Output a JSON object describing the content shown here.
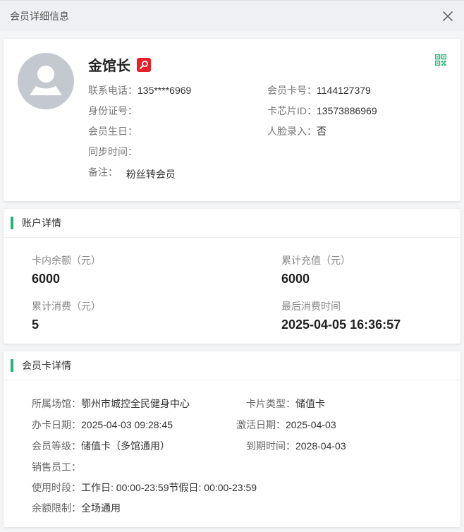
{
  "modal": {
    "title": "会员详细信息"
  },
  "member": {
    "name": "金馆长",
    "phone_label": "联系电话：",
    "phone": "135****6969",
    "card_no_label": "会员卡号：",
    "card_no": "1144127379",
    "id_label": "身份证号：",
    "id": "",
    "chip_label": "卡芯片ID：",
    "chip": "13573886969",
    "birthday_label": "会员生日：",
    "birthday": "",
    "face_label": "人脸录入：",
    "face": "否",
    "sync_label": "同步时间：",
    "sync": "",
    "note_label": "备注：",
    "note": "粉丝转会员"
  },
  "account": {
    "title": "账户详情",
    "balance_label": "卡内余额（元）",
    "balance": "6000",
    "recharge_label": "累计充值（元）",
    "recharge": "6000",
    "spend_label": "累计消费（元）",
    "spend": "5",
    "last_label": "最后消费时间",
    "last": "2025-04-05 16:36:57"
  },
  "card": {
    "title": "会员卡详情",
    "venue_label": "所属场馆：",
    "venue": "鄂州市城控全民健身中心",
    "type_label": "卡片类型：",
    "type": "储值卡",
    "issue_label": "办卡日期：",
    "issue": "2025-04-03 09:28:45",
    "activate_label": "激活日期：",
    "activate": "2025-04-03",
    "level_label": "会员等级：",
    "level": "储值卡（多馆通用）",
    "expire_label": "到期时间：",
    "expire": "2028-04-03",
    "sales_label": "销售员工：",
    "sales": "",
    "period_label": "使用时段：",
    "period": "工作日: 00:00-23:59节假日: 00:00-23:59",
    "limit_label": "余额限制：",
    "limit": "全场通用"
  },
  "colors": {
    "accent": "#24b473",
    "badge": "#e8202c",
    "avatar": "#c4c8cf"
  }
}
